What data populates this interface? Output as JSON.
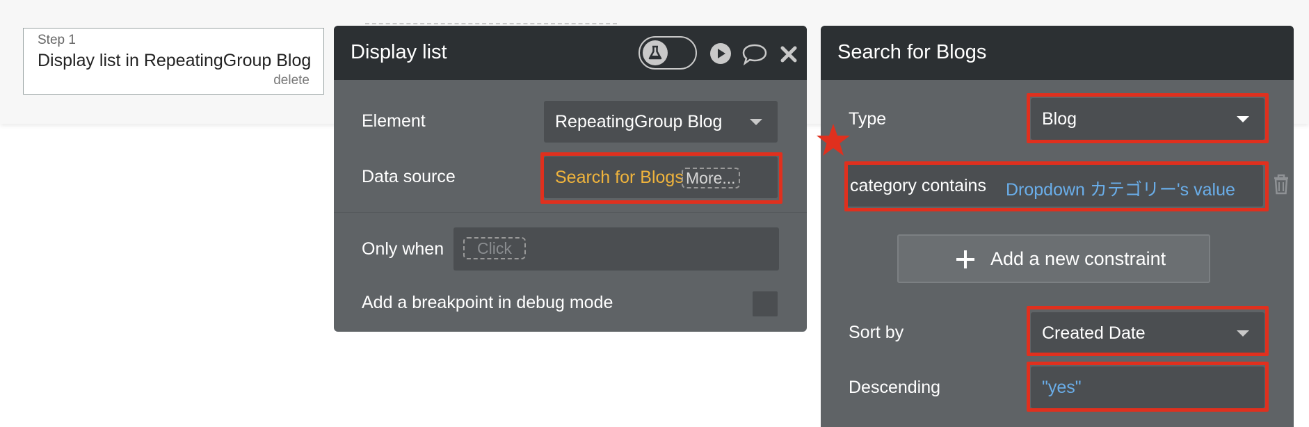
{
  "step": {
    "number": "Step 1",
    "title": "Display list in RepeatingGroup Blog",
    "delete_label": "delete"
  },
  "display_panel": {
    "title": "Display list",
    "element_label": "Element",
    "element_value": "RepeatingGroup Blog",
    "data_source_label": "Data source",
    "data_source_value": "Search for Blogs",
    "data_source_more": "More...",
    "only_when_label": "Only when",
    "only_when_placeholder": "Click",
    "breakpoint_label": "Add a breakpoint in debug mode"
  },
  "search_panel": {
    "title": "Search for Blogs",
    "type_label": "Type",
    "type_value": "Blog",
    "constraint_key": "category contains",
    "constraint_value": "Dropdown カテゴリー's value",
    "add_constraint_label": "Add a new constraint",
    "sort_by_label": "Sort by",
    "sort_by_value": "Created Date",
    "descending_label": "Descending",
    "descending_value": "\"yes\""
  },
  "icons": {
    "toggle": "debug-flask-toggle-icon",
    "run": "play-icon",
    "comment": "comment-bubble-icon",
    "close": "close-icon",
    "trash": "trash-icon",
    "plus": "plus-icon",
    "star": "star-icon"
  },
  "colors": {
    "highlight": "#e0301e",
    "header_bg": "#2c3033",
    "panel_bg": "#5f6366",
    "field_bg": "#4b4e51",
    "dynamic_orange": "#f0b43c",
    "dynamic_blue": "#6aaeea"
  }
}
